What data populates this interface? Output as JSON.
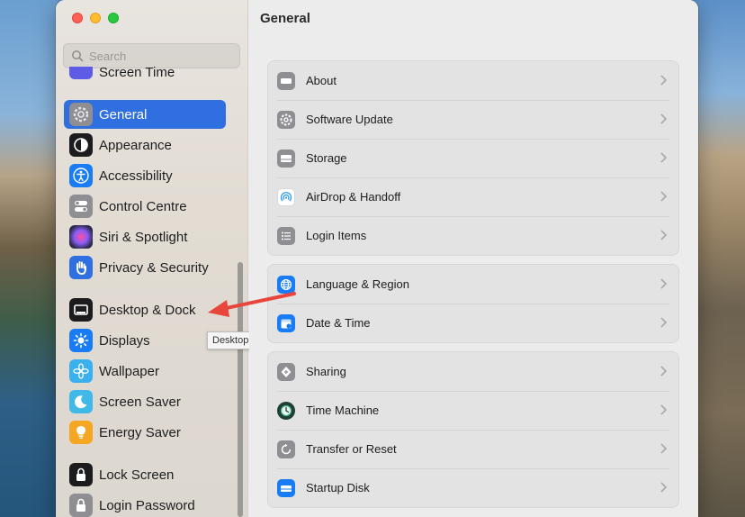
{
  "window": {
    "title": "General"
  },
  "search": {
    "placeholder": "Search"
  },
  "sidebar": {
    "items": [
      {
        "label": "Screen Time",
        "icon": "screen-time-icon",
        "color": "#5e5ce6"
      },
      {
        "label": "General",
        "icon": "gear-icon",
        "color": "#8e8e93",
        "active": true
      },
      {
        "label": "Appearance",
        "icon": "appearance-icon",
        "color": "#1c1c1e"
      },
      {
        "label": "Accessibility",
        "icon": "accessibility-icon",
        "color": "#1a7cf5"
      },
      {
        "label": "Control Centre",
        "icon": "control-centre-icon",
        "color": "#8e8e93"
      },
      {
        "label": "Siri & Spotlight",
        "icon": "siri-icon",
        "color": "#3a3a5e"
      },
      {
        "label": "Privacy & Security",
        "icon": "hand-icon",
        "color": "#2f6fe0"
      },
      {
        "label": "Desktop & Dock",
        "icon": "dock-icon",
        "color": "#1c1c1e"
      },
      {
        "label": "Displays",
        "icon": "sun-icon",
        "color": "#1a7cf5"
      },
      {
        "label": "Wallpaper",
        "icon": "flower-icon",
        "color": "#3ab0ef"
      },
      {
        "label": "Screen Saver",
        "icon": "moon-icon",
        "color": "#40b8e8"
      },
      {
        "label": "Energy Saver",
        "icon": "bulb-icon",
        "color": "#f5a623"
      },
      {
        "label": "Lock Screen",
        "icon": "lock-icon",
        "color": "#1c1c1e"
      },
      {
        "label": "Login Password",
        "icon": "lock-icon",
        "color": "#8e8e93"
      }
    ]
  },
  "tooltip": {
    "text": "Desktop & Dock"
  },
  "main": {
    "groups": [
      {
        "rows": [
          {
            "label": "About",
            "icon": "about-icon",
            "color": "#8e8e93"
          },
          {
            "label": "Software Update",
            "icon": "gear-icon",
            "color": "#8e8e93"
          },
          {
            "label": "Storage",
            "icon": "storage-icon",
            "color": "#8e8e93"
          },
          {
            "label": "AirDrop & Handoff",
            "icon": "airdrop-icon",
            "color": "#ffffff"
          },
          {
            "label": "Login Items",
            "icon": "list-icon",
            "color": "#8e8e93"
          }
        ]
      },
      {
        "rows": [
          {
            "label": "Language & Region",
            "icon": "globe-icon",
            "color": "#1a7cf5"
          },
          {
            "label": "Date & Time",
            "icon": "calendar-icon",
            "color": "#1a7cf5"
          }
        ]
      },
      {
        "rows": [
          {
            "label": "Sharing",
            "icon": "sharing-icon",
            "color": "#8e8e93"
          },
          {
            "label": "Time Machine",
            "icon": "time-machine-icon",
            "color": "#2a6e5c"
          },
          {
            "label": "Transfer or Reset",
            "icon": "reset-icon",
            "color": "#8e8e93"
          },
          {
            "label": "Startup Disk",
            "icon": "disk-icon",
            "color": "#1a7cf5"
          }
        ]
      }
    ]
  },
  "annotation": {
    "arrow_color": "#e8453c"
  }
}
